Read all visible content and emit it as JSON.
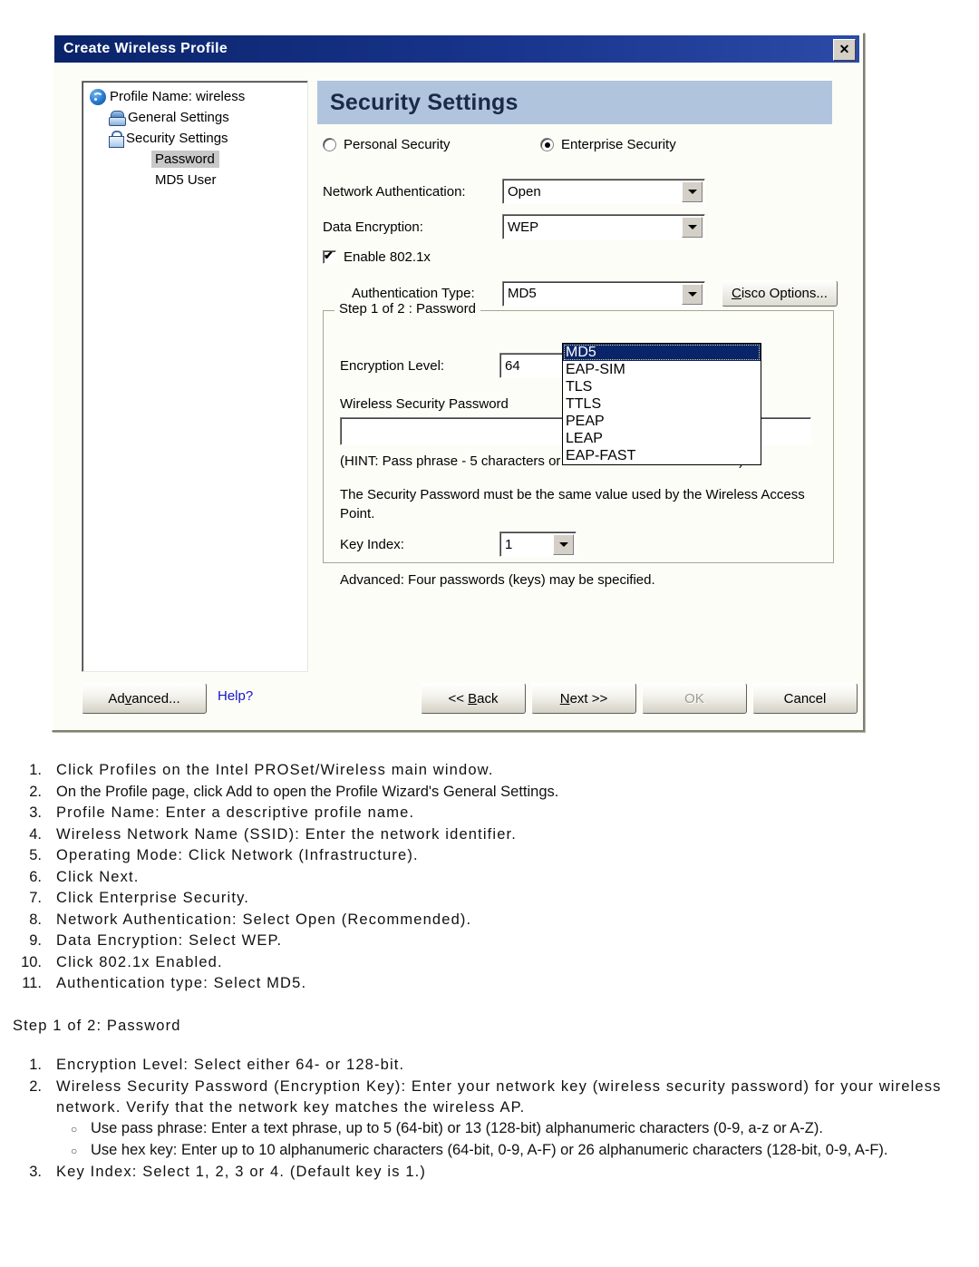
{
  "dialog": {
    "title": "Create Wireless Profile",
    "close_label": "✖",
    "tree": [
      {
        "label": "Profile Name: wireless",
        "icon": "wifi-icon",
        "selected": false
      },
      {
        "label": "General Settings",
        "icon": "general-settings-icon",
        "selected": false
      },
      {
        "label": "Security Settings",
        "icon": "lock-icon",
        "selected": false
      },
      {
        "label": "Password",
        "icon": "",
        "selected": true
      },
      {
        "label": "MD5 User",
        "icon": "",
        "selected": false
      }
    ],
    "page_title": "Security Settings",
    "security_mode": {
      "personal_label": "Personal Security",
      "enterprise_label": "Enterprise Security",
      "selected": "enterprise"
    },
    "fields": {
      "network_auth_label": "Network Authentication:",
      "network_auth_value": "Open",
      "data_encryption_label": "Data Encryption:",
      "data_encryption_value": "WEP",
      "enable_8021x_label": "Enable 802.1x",
      "enable_8021x_checked": true,
      "auth_type_label": "Authentication Type:",
      "auth_type_value": "MD5",
      "cisco_options_label": "Cisco Options..."
    },
    "auth_type_options": [
      {
        "label": "MD5",
        "selected": true
      },
      {
        "label": "EAP-SIM",
        "selected": false
      },
      {
        "label": "TLS",
        "selected": false
      },
      {
        "label": "TTLS",
        "selected": false
      },
      {
        "label": "PEAP",
        "selected": false
      },
      {
        "label": "LEAP",
        "selected": false
      },
      {
        "label": "EAP-FAST",
        "selected": false
      }
    ],
    "group": {
      "legend": "Step 1 of 2 : Password",
      "encryption_level_label": "Encryption Level:",
      "encryption_level_value": "64",
      "password_label": "Wireless Security Password",
      "password_value": "",
      "hint": "(HINT: Pass phrase - 5 characters or Hex - 10 hexadecimal values)",
      "note": "The Security Password must be the same value used by the Wireless Access Point.",
      "key_index_label": "Key Index:",
      "key_index_value": "1",
      "advanced_note": "Advanced: Four passwords (keys) may be specified."
    },
    "buttons": {
      "advanced": "Advanced...",
      "help": "Help?",
      "back": "<< Back",
      "next": "Next >>",
      "ok": "OK",
      "cancel": "Cancel"
    }
  },
  "doc": {
    "steps": [
      {
        "num": "1.",
        "text": "Click Profiles on the Intel PROSet/Wireless main window."
      },
      {
        "num": "2.",
        "text": "On the Profile page, click Add to open the Profile Wizard's General Settings."
      },
      {
        "num": "3.",
        "text": "Profile Name: Enter a descriptive profile name."
      },
      {
        "num": "4.",
        "text": "Wireless Network Name (SSID): Enter the network identifier."
      },
      {
        "num": "5.",
        "text": "Operating Mode: Click Network (Infrastructure)."
      },
      {
        "num": "6.",
        "text": "Click Next."
      },
      {
        "num": "7.",
        "text": "Click Enterprise Security."
      },
      {
        "num": "8.",
        "text": "Network Authentication: Select Open (Recommended)."
      },
      {
        "num": "9.",
        "text": "Data Encryption: Select WEP."
      },
      {
        "num": "10.",
        "text": "Click 802.1x Enabled."
      },
      {
        "num": "11.",
        "text": "Authentication type: Select MD5."
      }
    ],
    "step_heading": "Step 1 of 2: Password",
    "substeps": [
      {
        "num": "1.",
        "text": "Encryption Level: Select either 64- or 128-bit."
      },
      {
        "num": "2.",
        "text": "Wireless Security Password (Encryption Key): Enter your network key (wireless security password) for your wireless network. Verify that the network key matches the wireless AP."
      },
      {
        "num": "3.",
        "text": "Key Index: Select 1, 2, 3 or 4. (Default key is 1.)"
      }
    ],
    "bullets": [
      {
        "marker": "○",
        "text": "Use pass phrase: Enter a text phrase, up to 5 (64-bit) or 13 (128-bit) alphanumeric characters (0-9, a-z or A-Z)."
      },
      {
        "marker": "○",
        "text": "Use hex key: Enter up to 10 alphanumeric characters (64-bit, 0-9, A-F) or 26 alphanumeric characters (128-bit, 0-9, A-F)."
      }
    ]
  },
  "colors": {
    "titlebar": "#0a246a",
    "header_band": "#b0c4de",
    "dropdown_highlight": "#0a246a",
    "help_link": "#1414cc",
    "dialog_bg": "#fdfdf7"
  }
}
